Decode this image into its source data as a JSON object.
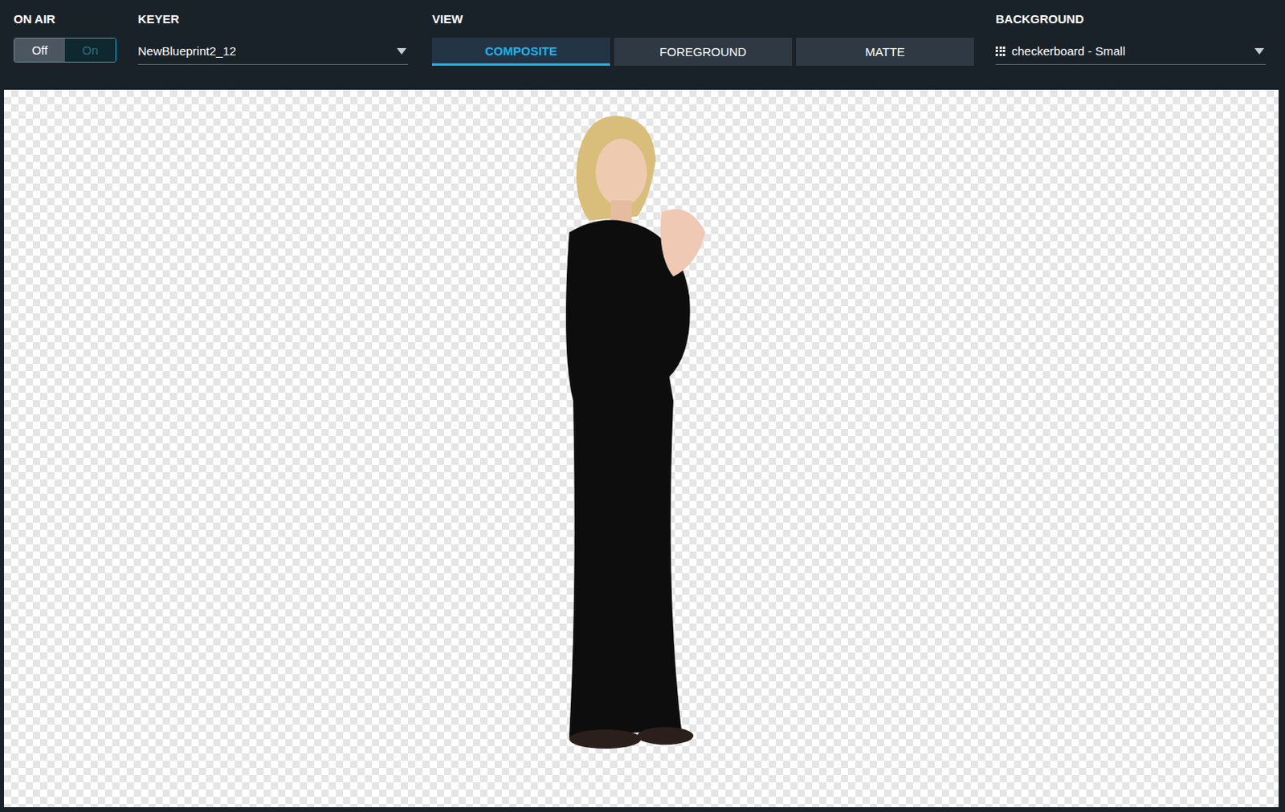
{
  "toolbar": {
    "on_air": {
      "label": "ON AIR",
      "options": [
        {
          "label": "Off",
          "selected": true
        },
        {
          "label": "On",
          "selected": false
        }
      ]
    },
    "keyer": {
      "label": "KEYER",
      "value": "NewBlueprint2_12"
    },
    "view": {
      "label": "VIEW",
      "tabs": [
        {
          "label": "COMPOSITE",
          "selected": true
        },
        {
          "label": "FOREGROUND",
          "selected": false
        },
        {
          "label": "MATTE",
          "selected": false
        }
      ]
    },
    "background": {
      "label": "BACKGROUND",
      "value": "checkerboard - Small"
    }
  },
  "preview": {
    "content": "keyed person on transparent checkerboard"
  }
}
